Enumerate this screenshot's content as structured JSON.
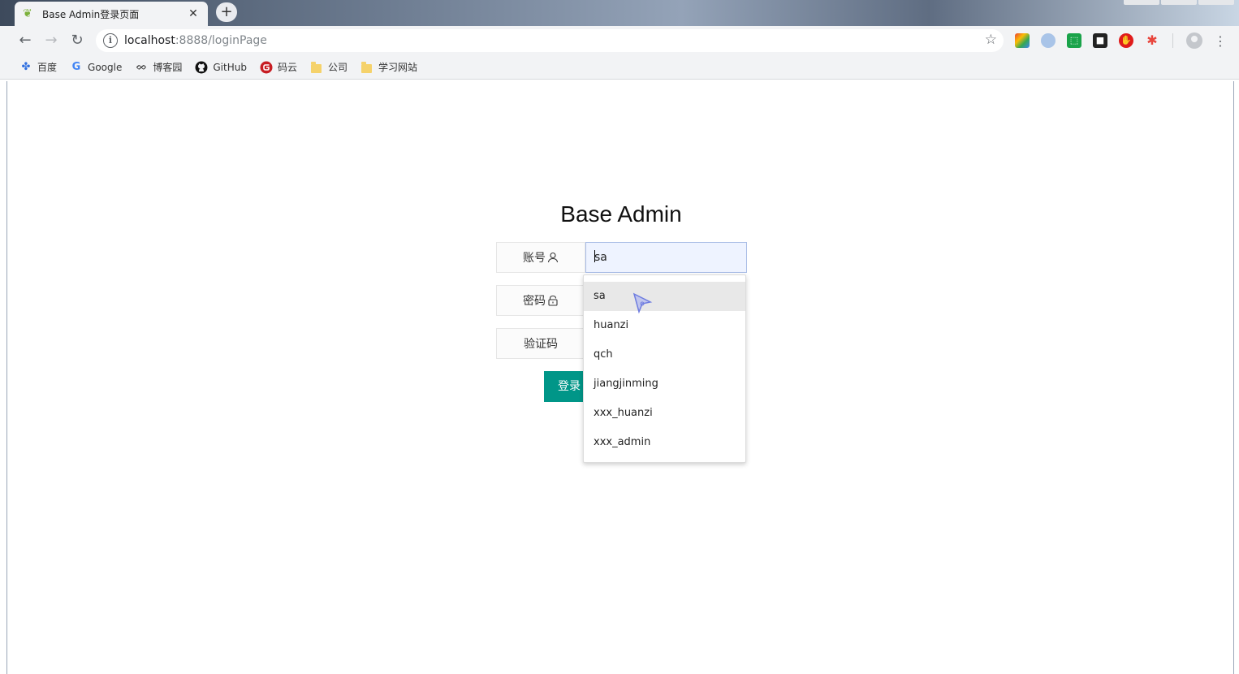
{
  "browser": {
    "tab_title": "Base Admin登录页面",
    "tab_close": "✕",
    "new_tab": "+",
    "url_host": "localhost",
    "url_rest": ":8888/loginPage",
    "bookmarks": [
      {
        "label": "百度",
        "icon": "baidu-paw-icon"
      },
      {
        "label": "Google",
        "icon": "google-g-icon"
      },
      {
        "label": "博客园",
        "icon": "cnblogs-icon"
      },
      {
        "label": "GitHub",
        "icon": "github-icon"
      },
      {
        "label": "码云",
        "icon": "gitee-icon"
      },
      {
        "label": "公司",
        "icon": "folder-icon"
      },
      {
        "label": "学习网站",
        "icon": "folder-icon"
      }
    ],
    "colors": {
      "accent": "#009688",
      "input_bg": "#eef3ff"
    }
  },
  "login": {
    "title": "Base Admin",
    "account_label": "账号",
    "account_value": "sa",
    "password_label": "密码",
    "captcha_label": "验证码",
    "submit_label": "登录",
    "autocomplete": [
      "sa",
      "huanzi",
      "qch",
      "jiangjinming",
      "xxx_huanzi",
      "xxx_admin"
    ]
  }
}
